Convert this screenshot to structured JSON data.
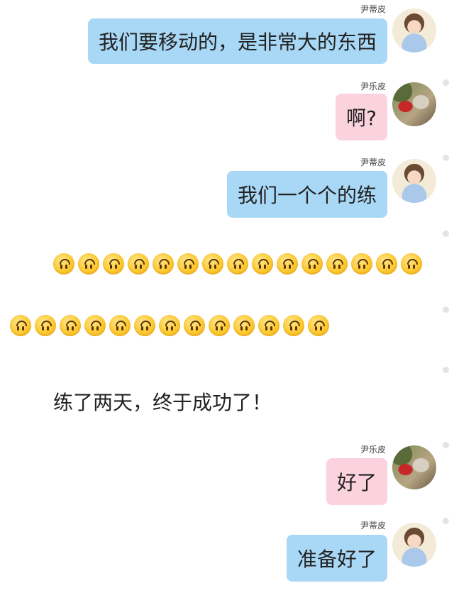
{
  "messages": [
    {
      "sender": "尹蒂皮",
      "text": "我们要移动的，是非常大的东西",
      "bubble": "blue",
      "avatar": "girl"
    },
    {
      "sender": "尹乐皮",
      "text": "啊?",
      "bubble": "pink",
      "avatar": "boy"
    },
    {
      "sender": "尹蒂皮",
      "text": "我们一个个的练",
      "bubble": "blue",
      "avatar": "girl"
    },
    {
      "sender": "尹乐皮",
      "text": "好了",
      "bubble": "pink",
      "avatar": "boy"
    },
    {
      "sender": "尹蒂皮",
      "text": "准备好了",
      "bubble": "blue",
      "avatar": "girl"
    }
  ],
  "emoji": {
    "name": "upside-down-face",
    "row1_count": 15,
    "row2_count": 13
  },
  "narration": "练了两天，终于成功了！",
  "colors": {
    "blue_bubble": "#a9d8f6",
    "pink_bubble": "#fbd3de",
    "emoji_yellow": "#fcc930"
  }
}
